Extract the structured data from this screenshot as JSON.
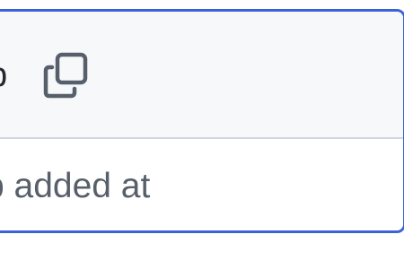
{
  "header": {
    "title_fragment": "p",
    "copy_icon": "copy-icon"
  },
  "body": {
    "description_fragment": "p added at"
  },
  "colors": {
    "border_accent": "#3b63d6",
    "header_bg": "#f6f8fa",
    "divider": "#d0d7de",
    "header_text": "#24292f",
    "body_text": "#57606a"
  }
}
